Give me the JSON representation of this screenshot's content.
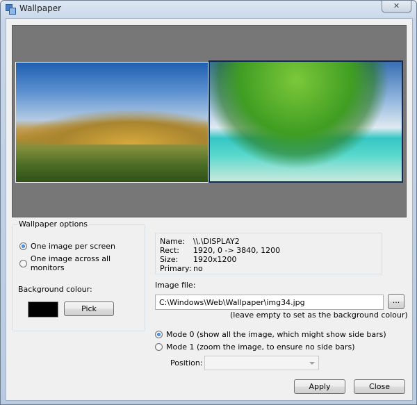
{
  "window": {
    "title": "Wallpaper"
  },
  "titlebar": {
    "close_glyph": "✕"
  },
  "options": {
    "group_title": "Wallpaper options",
    "radio_per_screen": "One image per screen",
    "radio_all_monitors": "One image across all monitors",
    "bg_colour_label": "Background colour:",
    "bg_colour_value": "#000000",
    "pick_label": "Pick"
  },
  "display_info": {
    "name_key": "Name:",
    "name_value": "\\\\.\\DISPLAY2",
    "rect_key": "Rect:",
    "rect_value": "1920, 0 -> 3840, 1200",
    "size_key": "Size:",
    "size_value": "1920x1200",
    "primary_key": "Primary:",
    "primary_value": "no"
  },
  "image_file": {
    "label": "Image file:",
    "value": "C:\\Windows\\Web\\Wallpaper\\img34.jpg",
    "browse_label": "...",
    "hint": "(leave empty to set as the background colour)"
  },
  "mode": {
    "mode0": "Mode 0 (show all the image, which might show side bars)",
    "mode1": "Mode 1 (zoom the image, to ensure no side bars)",
    "position_label": "Position:",
    "position_value": ""
  },
  "buttons": {
    "apply": "Apply",
    "close": "Close"
  },
  "preview": {
    "monitor1_image": "landscape-dunes-sky",
    "monitor2_image": "palm-leaf-beach",
    "selected_monitor": 2
  }
}
